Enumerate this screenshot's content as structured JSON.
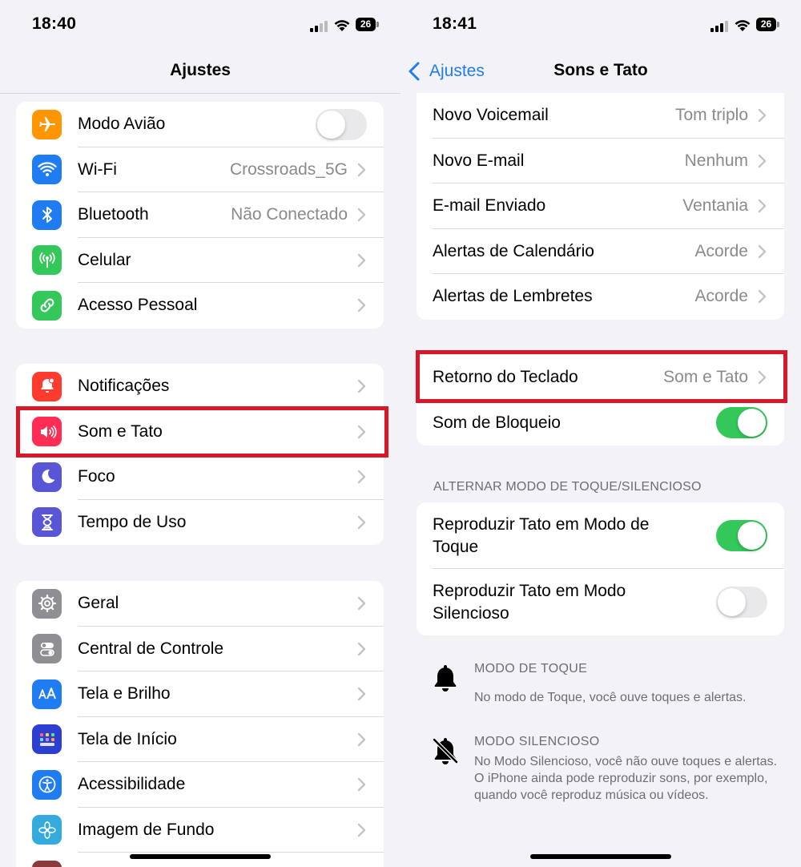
{
  "left_screen": {
    "status": {
      "time": "18:40",
      "battery": "26"
    },
    "nav_title": "Ajustes",
    "group1": [
      {
        "label": "Modo Avião",
        "icon": "airplane-icon",
        "color": "#ff9500"
      },
      {
        "label": "Wi-Fi",
        "value": "Crossroads_5G",
        "icon": "wifi-icon",
        "color": "#1f7cf2"
      },
      {
        "label": "Bluetooth",
        "value": "Não Conectado",
        "icon": "bluetooth-icon",
        "color": "#1f7cf2"
      },
      {
        "label": "Celular",
        "icon": "cellular-antenna-icon",
        "color": "#34c759"
      },
      {
        "label": "Acesso Pessoal",
        "icon": "link-chain-icon",
        "color": "#34c759"
      }
    ],
    "group2": [
      {
        "label": "Notificações",
        "icon": "notification-bell-icon",
        "color": "#ff3b30"
      },
      {
        "label": "Som e Tato",
        "icon": "speaker-icon",
        "color": "#ff2d55"
      },
      {
        "label": "Foco",
        "icon": "moon-icon",
        "color": "#5856d6"
      },
      {
        "label": "Tempo de Uso",
        "icon": "hourglass-icon",
        "color": "#5856d6"
      }
    ],
    "group3": [
      {
        "label": "Geral",
        "icon": "gear-icon",
        "color": "#8e8e93"
      },
      {
        "label": "Central de Controle",
        "icon": "switches-icon",
        "color": "#8e8e93"
      },
      {
        "label": "Tela e Brilho",
        "icon": "text-size-icon",
        "color": "#1f7cf2"
      },
      {
        "label": "Tela de Início",
        "icon": "home-grid-icon",
        "color": "#2d3fd0"
      },
      {
        "label": "Acessibilidade",
        "icon": "accessibility-icon",
        "color": "#1f7cf2"
      },
      {
        "label": "Imagem de Fundo",
        "icon": "flower-icon",
        "color": "#35aadc"
      }
    ],
    "toggles": {
      "airplane_mode": false
    },
    "highlighted_row": "Som e Tato"
  },
  "right_screen": {
    "status": {
      "time": "18:41",
      "battery": "26"
    },
    "back_label": "Ajustes",
    "nav_title": "Sons e Tato",
    "group1": [
      {
        "label": "Novo Voicemail",
        "value": "Tom triplo"
      },
      {
        "label": "Novo E-mail",
        "value": "Nenhum"
      },
      {
        "label": "E-mail Enviado",
        "value": "Ventania"
      },
      {
        "label": "Alertas de Calendário",
        "value": "Acorde"
      },
      {
        "label": "Alertas de Lembretes",
        "value": "Acorde"
      }
    ],
    "group2": [
      {
        "label": "Retorno do Teclado",
        "value": "Som e Tato"
      },
      {
        "label": "Som de Bloqueio",
        "toggle": true
      }
    ],
    "section_header": "ALTERNAR MODO DE TOQUE/SILENCIOSO",
    "group3": [
      {
        "label": "Reproduzir Tato em Modo de Toque",
        "toggle": true
      },
      {
        "label": "Reproduzir Tato em Modo Silencioso",
        "toggle": false
      }
    ],
    "info": [
      {
        "title": "MODO DE TOQUE",
        "body": "No modo de Toque, você ouve toques e alertas.",
        "icon": "bell-icon"
      },
      {
        "title": "MODO SILENCIOSO",
        "body": "No Modo Silencioso, você não ouve toques e alertas. O iPhone ainda pode reproduzir sons, por exemplo, quando você reproduz música ou vídeos.",
        "icon": "bell-slash-icon"
      }
    ],
    "highlighted_row": "Retorno do Teclado"
  },
  "colors": {
    "accent": "#1f7cf2",
    "toggle_on": "#34c759",
    "highlight": "#d7182a"
  }
}
